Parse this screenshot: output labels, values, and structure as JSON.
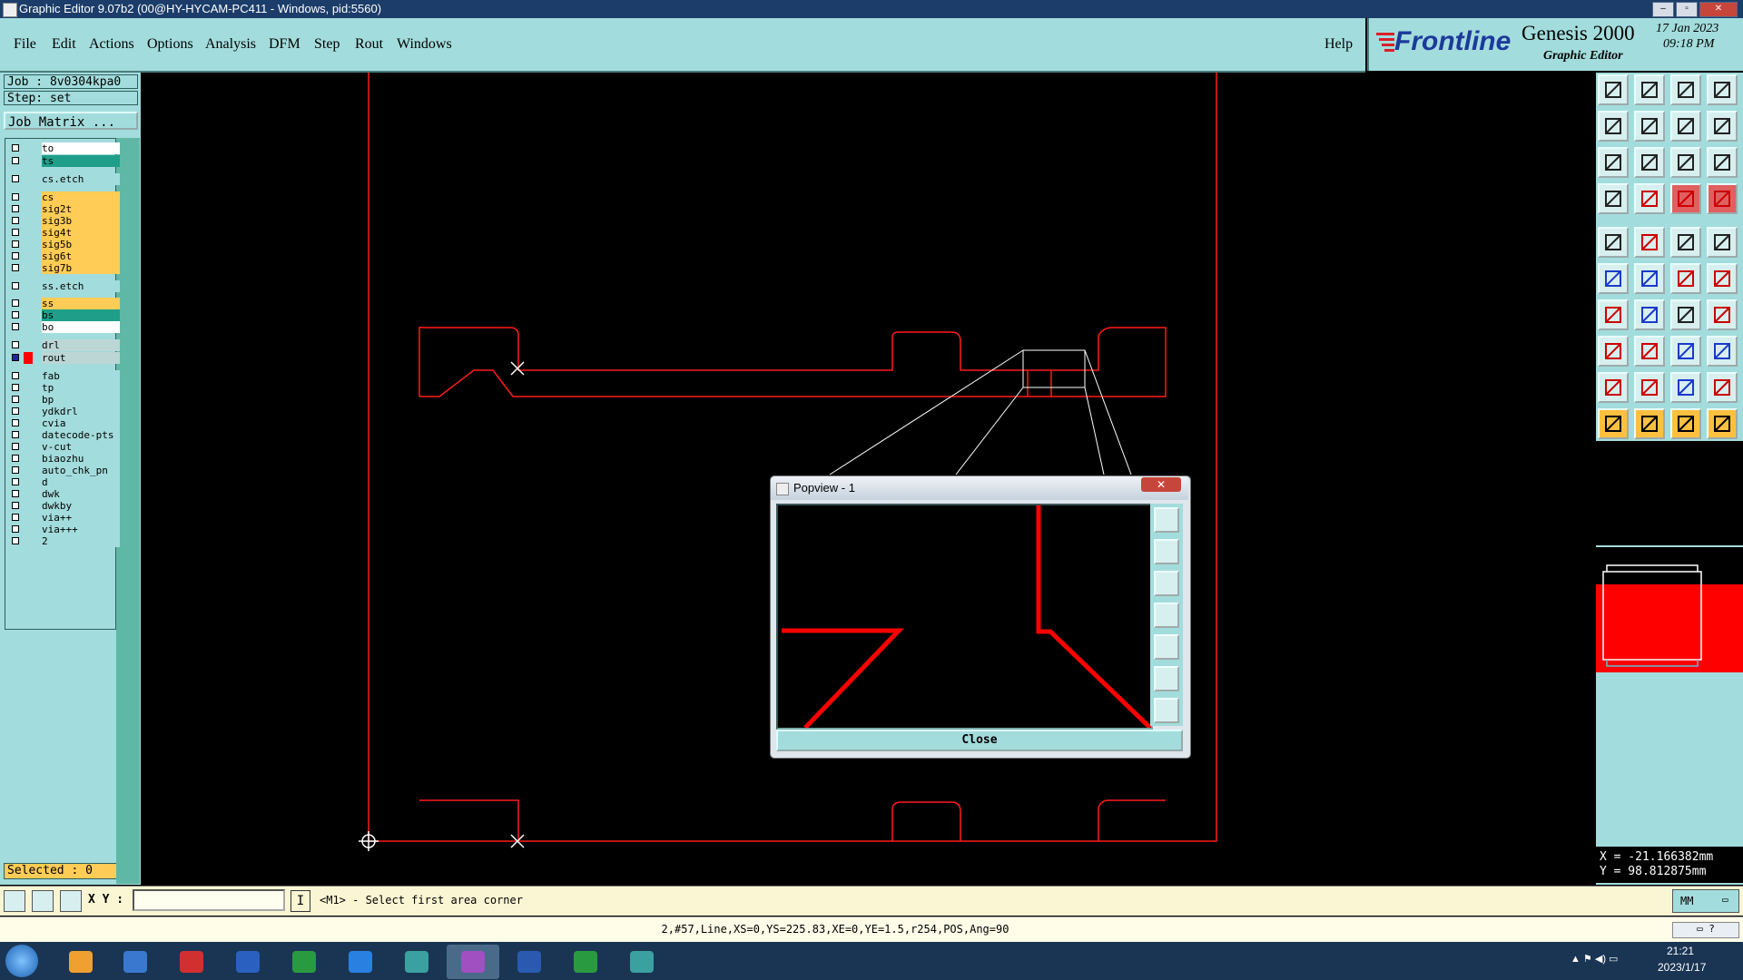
{
  "window": {
    "title": "Graphic Editor 9.07b2 (00@HY-HYCAM-PC411 - Windows, pid:5560)",
    "controls": [
      "–",
      "▫",
      "✕"
    ]
  },
  "menu": [
    "File",
    "Edit",
    "Actions",
    "Options",
    "Analysis",
    "DFM",
    "Step",
    "Rout",
    "Windows"
  ],
  "help": "Help",
  "brand": {
    "logo": "Frontline",
    "product": "Genesis 2000",
    "subtitle": "Graphic Editor",
    "date": "17 Jan 2023",
    "time": "09:18 PM"
  },
  "job": {
    "job_line": "Job : 8v0304kpa0",
    "step_line": "Step: set",
    "matrix_button": "Job Matrix ..."
  },
  "layers": [
    {
      "name": "to",
      "color": "#ffffff"
    },
    {
      "name": "ts",
      "color": "#1f9f8a"
    },
    {
      "name": "cs.etch",
      "color": "#a3dcdc"
    },
    {
      "name": "cs",
      "color": "#ffcc55"
    },
    {
      "name": "sig2t",
      "color": "#ffcc55"
    },
    {
      "name": "sig3b",
      "color": "#ffcc55"
    },
    {
      "name": "sig4t",
      "color": "#ffcc55"
    },
    {
      "name": "sig5b",
      "color": "#ffcc55"
    },
    {
      "name": "sig6t",
      "color": "#ffcc55"
    },
    {
      "name": "sig7b",
      "color": "#ffcc55"
    },
    {
      "name": "ss.etch",
      "color": "#a3dcdc"
    },
    {
      "name": "ss",
      "color": "#ffcc55"
    },
    {
      "name": "bs",
      "color": "#1f9f8a"
    },
    {
      "name": "bo",
      "color": "#ffffff"
    },
    {
      "name": "drl",
      "color": "#bcd6d6"
    },
    {
      "name": "rout",
      "color": "#bcd6d6"
    },
    {
      "name": "fab",
      "color": "#a3dcdc"
    },
    {
      "name": "tp",
      "color": "#a3dcdc"
    },
    {
      "name": "bp",
      "color": "#a3dcdc"
    },
    {
      "name": "ydkdrl",
      "color": "#a3dcdc"
    },
    {
      "name": "cvia",
      "color": "#a3dcdc"
    },
    {
      "name": "datecode-pts",
      "color": "#a3dcdc"
    },
    {
      "name": "v-cut",
      "color": "#a3dcdc"
    },
    {
      "name": "biaozhu",
      "color": "#a3dcdc"
    },
    {
      "name": "auto_chk_pn",
      "color": "#a3dcdc"
    },
    {
      "name": "d",
      "color": "#a3dcdc"
    },
    {
      "name": "dwk",
      "color": "#a3dcdc"
    },
    {
      "name": "dwkby",
      "color": "#a3dcdc"
    },
    {
      "name": "via++",
      "color": "#a3dcdc"
    },
    {
      "name": "via+++",
      "color": "#a3dcdc"
    },
    {
      "name": "2",
      "color": "#a3dcdc"
    }
  ],
  "selected": "Selected : 0",
  "popview": {
    "title": "Popview - 1",
    "close_button": "Close"
  },
  "coords": {
    "x": "X = -21.166382mm",
    "y": "Y = 98.812875mm"
  },
  "command": {
    "xy_label": "X Y :",
    "input_value": "",
    "prompt": "<M1> - Select first area corner",
    "units": "MM"
  },
  "status": "2,#57,Line,XS=0,YS=225.83,XE=0,YE=1.5,r254,POS,Ang=90",
  "taskbar": {
    "time": "21:21",
    "date": "2023/1/17"
  },
  "colors": {
    "panel": "#a3dcdc",
    "rout_line": "#ff0000",
    "canvas": "#000000"
  }
}
